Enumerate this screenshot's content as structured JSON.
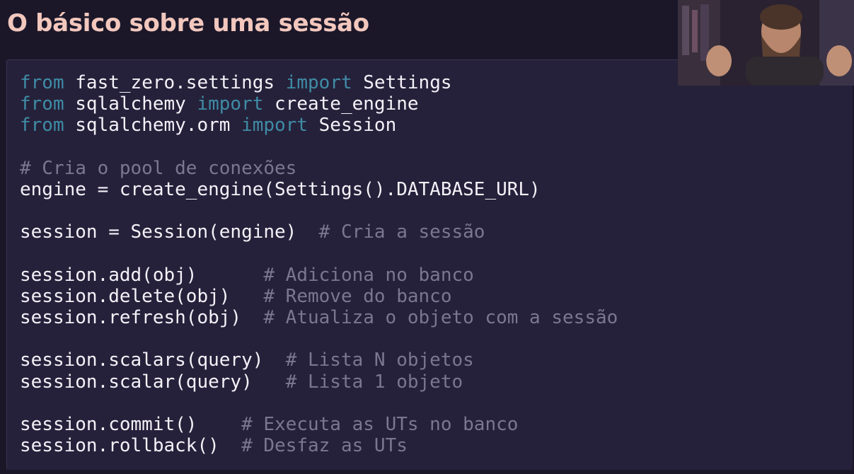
{
  "slide": {
    "title": "O básico sobre uma sessão"
  },
  "code": {
    "lines": [
      [
        {
          "t": "from",
          "k": "kw"
        },
        {
          "t": " fast_zero.settings ",
          "k": "tx"
        },
        {
          "t": "import",
          "k": "kw"
        },
        {
          "t": " Settings",
          "k": "tx"
        }
      ],
      [
        {
          "t": "from",
          "k": "kw"
        },
        {
          "t": " sqlalchemy ",
          "k": "tx"
        },
        {
          "t": "import",
          "k": "kw"
        },
        {
          "t": " create_engine",
          "k": "tx"
        }
      ],
      [
        {
          "t": "from",
          "k": "kw"
        },
        {
          "t": " sqlalchemy.orm ",
          "k": "tx"
        },
        {
          "t": "import",
          "k": "kw"
        },
        {
          "t": " Session",
          "k": "tx"
        }
      ],
      [],
      [
        {
          "t": "# Cria o pool de conexões",
          "k": "cm"
        }
      ],
      [
        {
          "t": "engine = create_engine(Settings().DATABASE_URL)",
          "k": "tx"
        }
      ],
      [],
      [
        {
          "t": "session = Session(engine)  ",
          "k": "tx"
        },
        {
          "t": "# Cria a sessão",
          "k": "cm"
        }
      ],
      [],
      [
        {
          "t": "session.add(obj)      ",
          "k": "tx"
        },
        {
          "t": "# Adiciona no banco",
          "k": "cm"
        }
      ],
      [
        {
          "t": "session.delete(obj)   ",
          "k": "tx"
        },
        {
          "t": "# Remove do banco",
          "k": "cm"
        }
      ],
      [
        {
          "t": "session.refresh(obj)  ",
          "k": "tx"
        },
        {
          "t": "# Atualiza o objeto com a sessão",
          "k": "cm"
        }
      ],
      [],
      [
        {
          "t": "session.scalars(query)  ",
          "k": "tx"
        },
        {
          "t": "# Lista N objetos",
          "k": "cm"
        }
      ],
      [
        {
          "t": "session.scalar(query)   ",
          "k": "tx"
        },
        {
          "t": "# Lista 1 objeto",
          "k": "cm"
        }
      ],
      [],
      [
        {
          "t": "session.commit()    ",
          "k": "tx"
        },
        {
          "t": "# Executa as UTs no banco",
          "k": "cm"
        }
      ],
      [
        {
          "t": "session.rollback()  ",
          "k": "tx"
        },
        {
          "t": "# Desfaz as UTs",
          "k": "cm"
        }
      ]
    ]
  },
  "colors": {
    "background": "#1b1729",
    "panel": "#26213a",
    "title": "#f2c7bd",
    "keyword": "#3f8ca6",
    "comment": "#7c7790",
    "text": "#f4f1f8"
  },
  "webcam": {
    "icon": "presenter-video-icon"
  }
}
